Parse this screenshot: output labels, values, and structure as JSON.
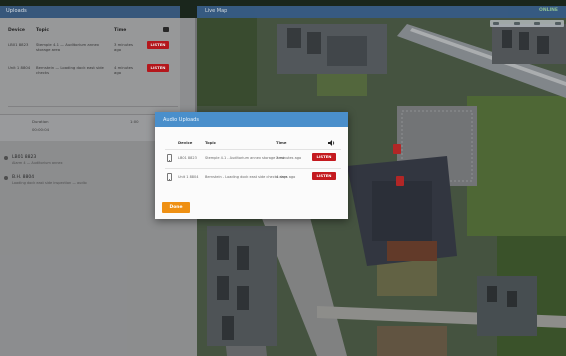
{
  "left_panel": {
    "header_title": "Uploads",
    "columns": {
      "device": "Device",
      "topic": "Topic",
      "time": "Time"
    },
    "rows": [
      {
        "device": "LB01 8823",
        "topic": "Stemple 4.1 — Auditorium annex storage area",
        "time": "3 minutes ago",
        "listen": "LISTEN"
      },
      {
        "device": "Unit 1 8804",
        "topic": "Bernstein — Loading dock east side checks",
        "time": "4 minutes ago",
        "listen": "LISTEN"
      }
    ],
    "meta": {
      "left_label": "Duration",
      "left_value": "00:00:04",
      "right_value": "1:00"
    },
    "events": [
      {
        "title": "LB01 8823",
        "sub": "Alarm 4 — Auditorium annex"
      },
      {
        "title": "B.H. 8804",
        "sub": "Loading dock east side inspection — audio"
      }
    ]
  },
  "map": {
    "title": "Live Map",
    "status": "ONLINE"
  },
  "modal": {
    "title": "Audio Uploads",
    "columns": {
      "device": "Device",
      "topic": "Topic",
      "time": "Time"
    },
    "rows": [
      {
        "device": "LB01 8823",
        "topic": "Stemple 4.1 - Auditorium annex storage area",
        "time": "3 minutes ago",
        "listen": "LISTEN"
      },
      {
        "device": "Unit 1 8804",
        "topic": "Bernstein - Loading dock east side checks area",
        "time": "4 days ago",
        "listen": "LISTEN"
      }
    ],
    "done_label": "Done"
  },
  "colors": {
    "modal_header": "#4a8fcb",
    "listen_button": "#c41a1f",
    "done_button": "#ef9013",
    "topbar": "#3c5f86"
  },
  "icons": [
    "speaker-icon",
    "phone-icon",
    "marker-icon"
  ]
}
